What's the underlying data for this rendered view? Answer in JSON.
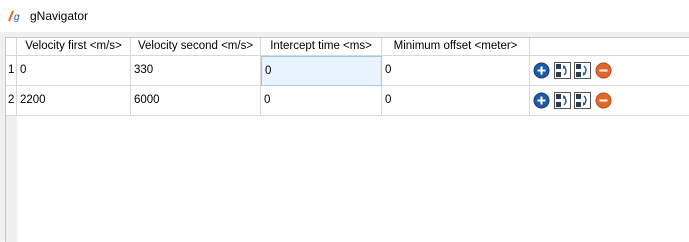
{
  "window": {
    "title": "gNavigator",
    "icon": "gnavigator-app-icon"
  },
  "table": {
    "columns": [
      "Velocity first <m/s>",
      "Velocity second <m/s>",
      "Intercept time <ms>",
      "Minimum offset <meter>"
    ],
    "rows": [
      {
        "index": "1",
        "cells": [
          "0",
          "330",
          "0",
          "0"
        ]
      },
      {
        "index": "2",
        "cells": [
          "2200",
          "6000",
          "0",
          "0"
        ]
      }
    ],
    "selected_cell": {
      "row": 0,
      "col": 2
    },
    "row_actions": [
      "add-row-icon",
      "move-row-up-icon",
      "move-row-down-icon",
      "remove-row-icon"
    ]
  },
  "colors": {
    "add": "#1e5aa8",
    "remove": "#e2662a",
    "selection": "#e8f3fd"
  }
}
